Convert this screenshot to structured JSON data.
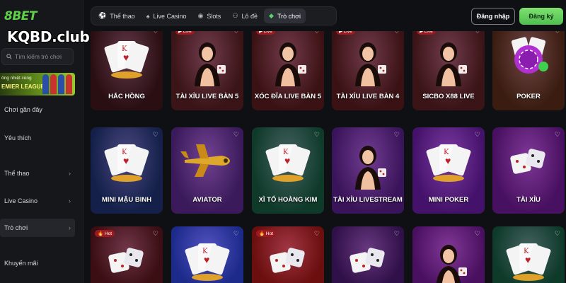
{
  "brand": {
    "logo_text": "8BET",
    "logo_prefix": "8",
    "watermark": "KQBD.club"
  },
  "search": {
    "placeholder": "Tìm kiếm trò chơi"
  },
  "promo": {
    "line1": "ông nhiệt cùng",
    "line2": "EMIER LEAGUE"
  },
  "sidebar": {
    "items": [
      {
        "label": "Chơi gần đây",
        "chevron": false
      },
      {
        "label": "Yêu thích",
        "chevron": false
      },
      {
        "label": "Thể thao",
        "chevron": true
      },
      {
        "label": "Live Casino",
        "chevron": true
      },
      {
        "label": "Trò chơi",
        "chevron": true,
        "active": true
      },
      {
        "label": "Khuyến mãi",
        "chevron": false
      }
    ]
  },
  "tabs": [
    {
      "label": "Thể thao",
      "icon": "soccer-icon"
    },
    {
      "label": "Live Casino",
      "icon": "casino-icon"
    },
    {
      "label": "Slots",
      "icon": "slots-icon"
    },
    {
      "label": "Lô đề",
      "icon": "lottery-icon"
    },
    {
      "label": "Trò chơi",
      "icon": "gamepad-icon",
      "active": true
    }
  ],
  "auth": {
    "login": "Đăng nhập",
    "register": "Đăng ký"
  },
  "badges": {
    "live": "Live",
    "hot": "Hot"
  },
  "games": {
    "row1": [
      {
        "title": "HẮC HỒNG",
        "badge": "",
        "bg": "#2a0f12"
      },
      {
        "title": "TÀI XỈU LIVE BÀN 5",
        "badge": "Live",
        "bg": "#3a1416"
      },
      {
        "title": "XÓC ĐĨA LIVE BÀN 5",
        "badge": "Live",
        "bg": "#3b1214"
      },
      {
        "title": "TÀI XỈU LIVE BÀN 4",
        "badge": "Live",
        "bg": "#3a1214"
      },
      {
        "title": "SICBO X88 LIVE",
        "badge": "Live",
        "bg": "#3a1416"
      },
      {
        "title": "POKER",
        "badge": "",
        "bg": "#3a1d10"
      }
    ],
    "row2": [
      {
        "title": "MINI MẬU BINH",
        "badge": "",
        "bg": "#14204a"
      },
      {
        "title": "AVIATOR",
        "badge": "",
        "bg": "#3a1a5a"
      },
      {
        "title": "XÌ TỐ HOÀNG KIM",
        "badge": "",
        "bg": "#0f3a2a"
      },
      {
        "title": "TÀI XỈU LIVESTREAM",
        "badge": "",
        "bg": "#3a145a"
      },
      {
        "title": "MINI POKER",
        "badge": "",
        "bg": "#44126a"
      },
      {
        "title": "TÀI XỈU",
        "badge": "",
        "bg": "#481060"
      }
    ],
    "row3": [
      {
        "title": "",
        "badge": "Hot",
        "bg": "#3a0e12"
      },
      {
        "title": "",
        "badge": "",
        "bg": "#1c2a8a"
      },
      {
        "title": "",
        "badge": "Hot",
        "bg": "#6a0e0e"
      },
      {
        "title": "",
        "badge": "",
        "bg": "#301048"
      },
      {
        "title": "",
        "badge": "",
        "bg": "#4a1060"
      },
      {
        "title": "",
        "badge": "",
        "bg": "#0e3a2a"
      }
    ]
  },
  "colors": {
    "accent": "#5fd36b",
    "live_badge": "#9a1a1f"
  }
}
